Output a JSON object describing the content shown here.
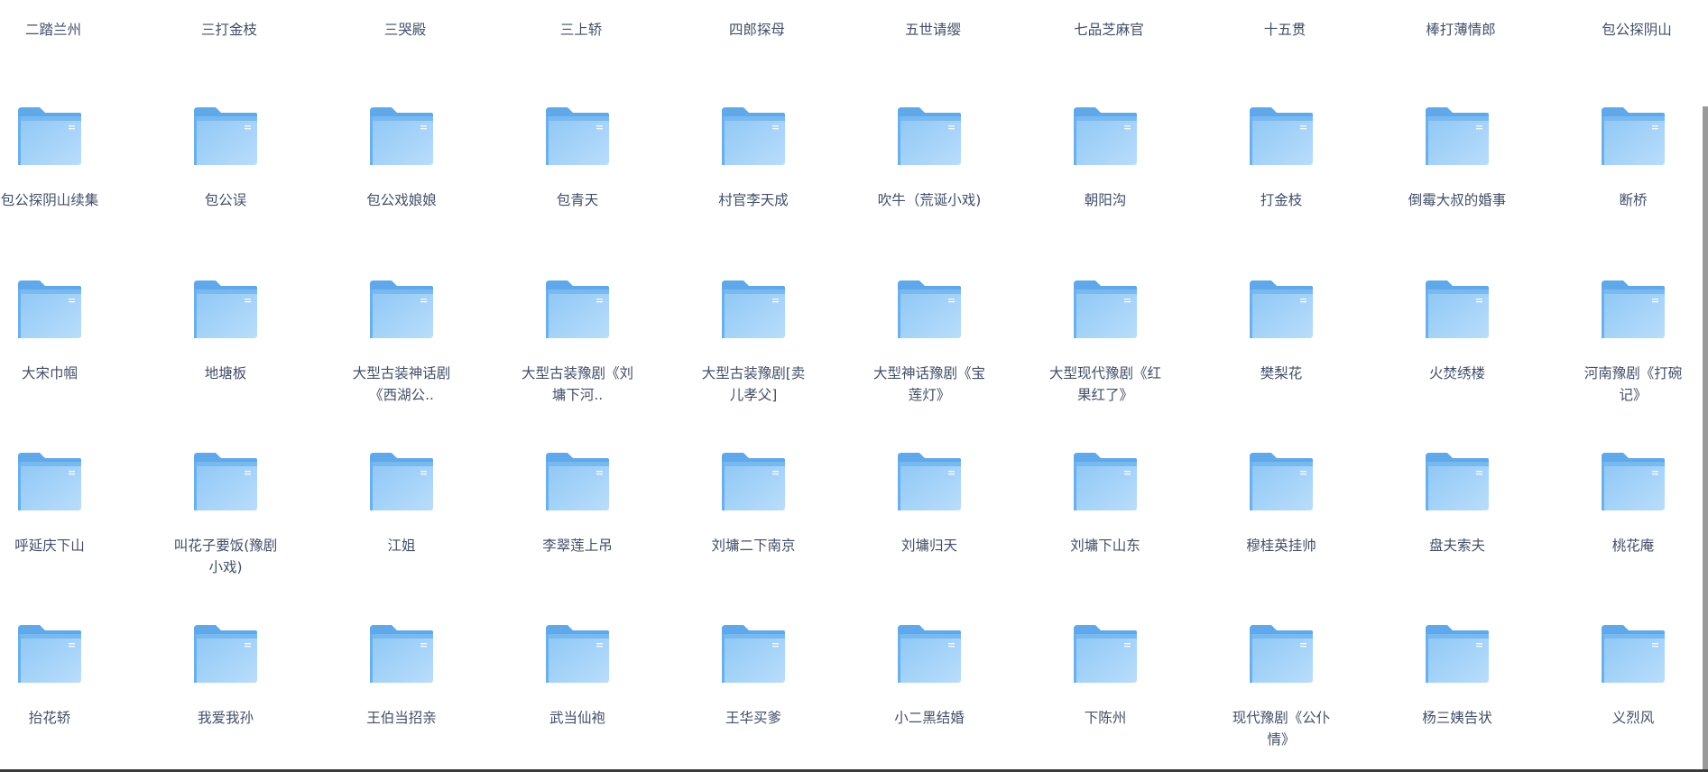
{
  "top_row": [
    "二踏兰州",
    "三打金枝",
    "三哭殿",
    "三上轿",
    "四郎探母",
    "五世请缨",
    "七品芝麻官",
    "十五贯",
    "棒打薄情郎",
    "包公探阴山"
  ],
  "rows": [
    [
      "包公探阴山续集",
      "包公误",
      "包公戏娘娘",
      "包青天",
      "村官李天成",
      "吹牛（荒诞小戏)",
      "朝阳沟",
      "打金枝",
      "倒霉大叔的婚事",
      "断桥"
    ],
    [
      "大宋巾帼",
      "地塘板",
      "大型古装神话剧《西湖公..",
      "大型古装豫剧《刘墉下河..",
      "大型古装豫剧[卖儿孝父]",
      "大型神话豫剧《宝莲灯》",
      "大型现代豫剧《红果红了》",
      "樊梨花",
      "火焚绣楼",
      "河南豫剧《打碗记》"
    ],
    [
      "呼延庆下山",
      "叫花子要饭(豫剧小戏)",
      "江姐",
      "李翠莲上吊",
      "刘墉二下南京",
      "刘墉归天",
      "刘墉下山东",
      "穆桂英挂帅",
      "盘夫索夫",
      "桃花庵"
    ],
    [
      "抬花轿",
      "我爱我孙",
      "王伯当招亲",
      "武当仙袍",
      "王华买爹",
      "小二黑结婚",
      "下陈州",
      "现代豫剧《公仆情》",
      "杨三姨告状",
      "义烈风"
    ]
  ]
}
